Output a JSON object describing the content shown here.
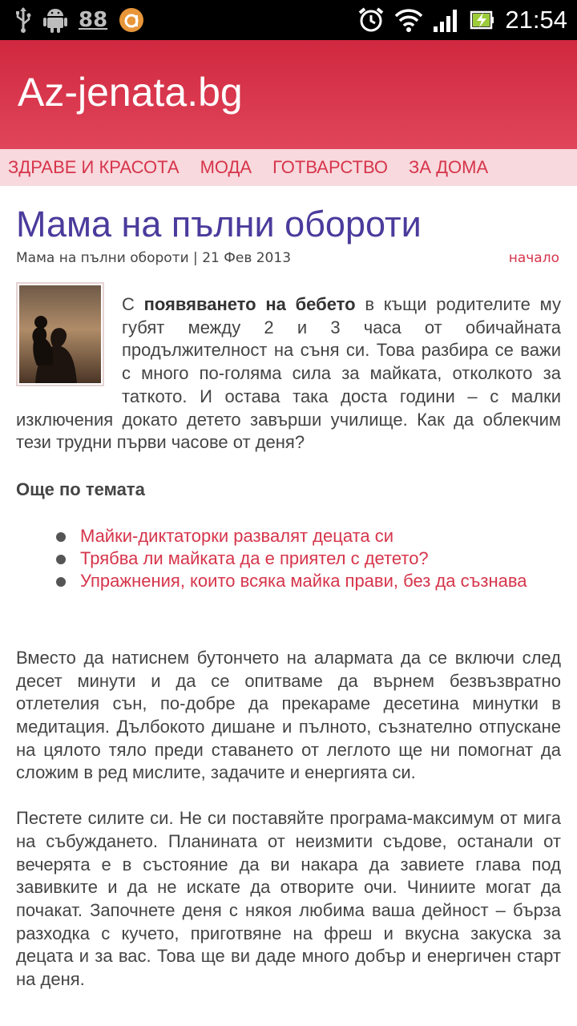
{
  "status_bar": {
    "badge": "88",
    "time": "21:54",
    "icons": [
      "usb-icon",
      "android-debug-icon",
      "notification-88-icon",
      "app-circle-icon",
      "alarm-icon",
      "wifi-icon",
      "signal-icon",
      "battery-charging-icon"
    ]
  },
  "header": {
    "site_title": "Az-jenata.bg",
    "bg_color": "#d6334a"
  },
  "nav": {
    "items": [
      {
        "label": "ЗДРАВЕ И КРАСОТА"
      },
      {
        "label": "МОДА"
      },
      {
        "label": "ГОТВАРСТВО"
      },
      {
        "label": "ЗА ДОМА"
      }
    ]
  },
  "article": {
    "title": "Мама на пълни обороти",
    "meta": "Мама на пълни обороти | 21 Фев 2013",
    "home_link": "начало",
    "intro_prefix": "С ",
    "intro_bold": "появяването на бебето",
    "intro_rest": " в къщи родителите му губят между 2 и 3 часа от обичайната продължителност на съня си. Това разбира се важи с много по-голяма сила за майката, отколкото за таткото. И остава така доста години – с малки изключения докато детето завърши училище. Как да облекчим тези трудни първи часове от деня?",
    "more_heading": "Още по темата",
    "related": [
      {
        "label": "Майки-диктаторки развалят децата си"
      },
      {
        "label": "Трябва ли майката да е приятел с детето?"
      },
      {
        "label": "Упражнения, които всяка майка прави, без да съзнава"
      }
    ],
    "paragraph_2": "Вместо да натиснем бутончето на алармата да се включи след десет минути и да се опитваме да върнем безвъзвратно отлетелия сън, по-добре да прекараме десетина минутки в медитация. Дълбокото дишане и пълното, съзнателно отпускане на цялото тяло преди ставането от леглото ще ни помогнат да сложим в ред мислите, задачите и енергията си.",
    "paragraph_3": "Пестете силите си. Не си поставяйте програма-максимум от мига на събуждането. Планината от неизмити съдове, останали от вечерята е в състояние да ви накара да завиете глава под завивките и да не искате да отворите очи. Чиниите могат да почакат. Започнете деня с някоя любима ваша дейност – бърза разходка с кучето, приготвяне на фреш и вкусна закуска за децата и за вас. Това ще ви даде много добър и енергичен старт на деня."
  }
}
